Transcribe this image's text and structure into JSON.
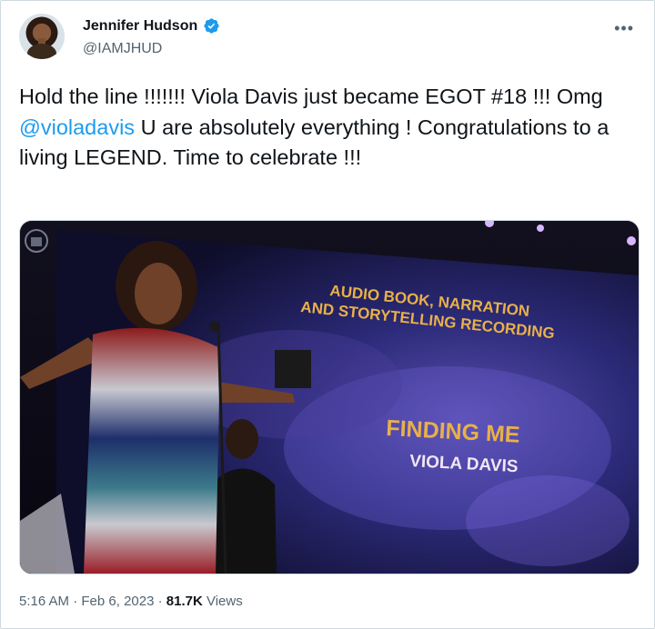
{
  "author": {
    "name": "Jennifer Hudson",
    "handle": "@IAMJHUD",
    "verified_icon": "verified-badge-icon"
  },
  "tweet": {
    "text_part1": "Hold the line !!!!!!! Viola Davis just became EGOT #18 !!! Omg ",
    "mention": "@violadavis",
    "text_part2": " U are absolutely everything ! Congratulations to a living LEGEND. Time to celebrate !!!"
  },
  "media": {
    "screen_category_line1": "AUDIO BOOK, NARRATION",
    "screen_category_line2": "AND STORYTELLING RECORDING",
    "screen_title": "FINDING ME",
    "screen_artist": "VIOLA DAVIS"
  },
  "meta": {
    "time": "5:16 AM",
    "sep1": " · ",
    "date": "Feb 6, 2023",
    "sep2": " · ",
    "views": "81.7K",
    "views_label": " Views"
  },
  "colors": {
    "accent": "#1d9bf0",
    "secondary_text": "#536471",
    "border": "#cfd9de"
  }
}
